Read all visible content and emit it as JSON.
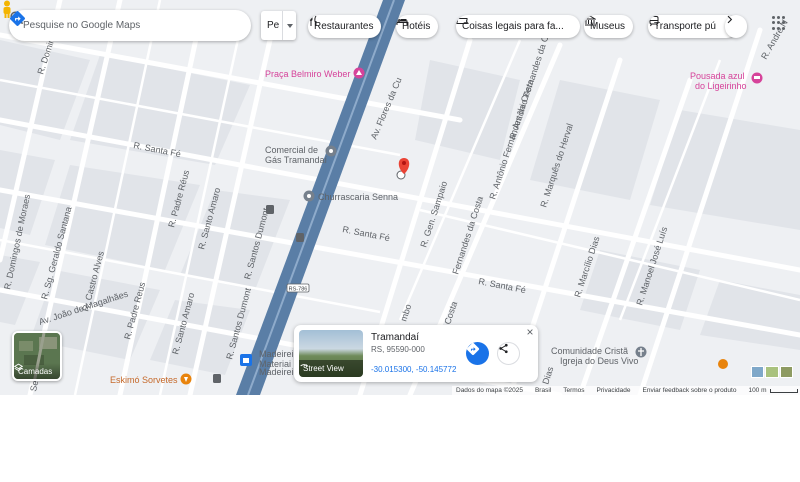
{
  "search": {
    "placeholder": "Pesquise no Google Maps"
  },
  "language_button": {
    "label": "Pe"
  },
  "chips": [
    {
      "label": "Restaurantes",
      "icon": "restaurant-icon"
    },
    {
      "label": "Hotéis",
      "icon": "hotel-icon"
    },
    {
      "label": "Coisas legais para fa...",
      "icon": "ticket-icon"
    },
    {
      "label": "Museus",
      "icon": "museum-icon"
    },
    {
      "label": "Transporte pú",
      "icon": "transit-icon"
    }
  ],
  "map": {
    "streets": {
      "flores_da_cunha": "Av. Flores da Cu",
      "domingos": "R. Domingos",
      "santa_fe_left": "R. Santa Fé",
      "santa_fe_mid": "R. Santa Fé",
      "santa_fe_right": "R. Santa Fé",
      "padre_reus_1": "R. Padre Réus",
      "padre_reus_2": "R. Padre Reus",
      "santo_amaro_1": "R. Santo Amaro",
      "santo_amaro_2": "R. Santo Amaro",
      "santos_dumont_1": "R. Santos Dumont",
      "santos_dumont_2": "R. Santos Dumont",
      "domingos_de_moraes": "R. Domingos de Moraes",
      "geraldo_santana": "R. Sg. Geraldo Santana",
      "castro_alves": "R. Castro Alves",
      "joao_de_magalhaes": "Av. João de Magalhães",
      "sebastiao_luiz": "Sebastião Luiz",
      "gen_sampaio": "R. Gen. Sampaio",
      "antonio_fernandes_1": "R. Antônio Fernandes da Costa",
      "antonio_fernandes_2": "R. Antônio Fernandes da Costa",
      "antonio_fernandes_3": "Fernandes da Costa",
      "marques_do_herval": "R. Marquês do Herval",
      "marcilio_dias_1": "R. Marcílio Dias",
      "marcilio_dias_2": "Dias",
      "manoel_jose_luis": "R. Manoel José Luís",
      "andre_n": "R. André N",
      "rembo": "mbo",
      "costa": "Costa",
      "rs786": "RS-786"
    },
    "pois": {
      "praca": "Praça Belmiro Weber",
      "pousada_1": "Pousada azul",
      "pousada_2": "do Ligeirinho",
      "comercial_1": "Comercial de",
      "comercial_2": "Gás Tramandaí",
      "churrascaria": "Churrascaria Senna",
      "madeireira_1": "Madeirei",
      "madeireira_2": "Materiai",
      "madeireira_3": "Madeireira",
      "eskimo": "Eskimó Sorvetes",
      "comunidade_1": "Comunidade Cristã",
      "comunidade_2": "Igreja do Deus Vivo"
    }
  },
  "layers": {
    "label": "Camadas"
  },
  "card": {
    "title": "Tramandaí",
    "address": "RS, 95590-000",
    "coords": "-30.015300, -50.145772",
    "street_view_label": "Street View"
  },
  "footer": {
    "map_data": "Dados do mapa ©2025",
    "country": "Brasil",
    "terms": "Termos",
    "privacy": "Privacidade",
    "feedback": "Enviar feedback sobre o produto",
    "scale": "100 m"
  },
  "colors": {
    "road_main": "#5a7ea6",
    "road_white": "#ffffff",
    "map_bg": "#eef0f3",
    "block": "#dfe2e7",
    "pin_red": "#ea4335",
    "brand_blue": "#1a73e8",
    "poi_pink": "#d6439a",
    "poi_grey": "#76808c",
    "poi_orange": "#e8830c"
  }
}
